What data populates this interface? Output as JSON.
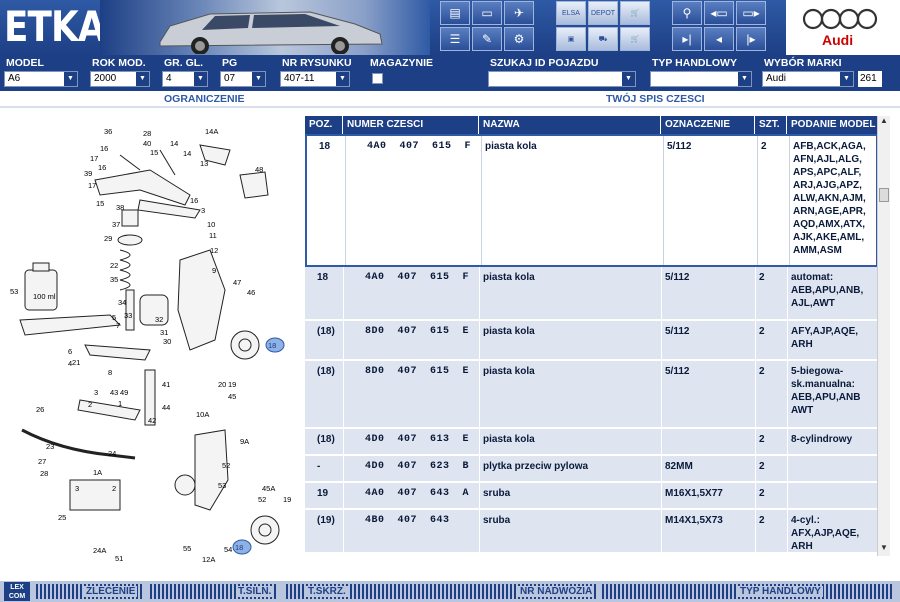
{
  "header": {
    "logo": "ETKA",
    "brand": "Audi"
  },
  "toolbar": {
    "icons": [
      "printer-icon",
      "monitor-icon",
      "fax-icon",
      "list-icon",
      "edit-icon",
      "parts-icon",
      "elsa-icon",
      "depot-icon",
      "cart-icon",
      "pin-icon",
      "prev-page-icon",
      "page-icon",
      "next-page-icon",
      "first-icon",
      "back-icon",
      "forward-icon",
      "last-icon"
    ],
    "elsa_label": "ELSA",
    "depot_label": "DEPOT"
  },
  "filters": {
    "model_label": "MODEL",
    "model_value": "A6",
    "year_label": "ROK MOD.",
    "year_value": "2000",
    "group_label": "GR. GL.",
    "group_value": "4",
    "pg_label": "PG",
    "pg_value": "07",
    "drawing_label": "NR RYSUNKU",
    "drawing_value": "407-11",
    "warehouse_label": "MAGAZYNIE",
    "search_label": "SZUKAJ ID POJAZDU",
    "search_value": "",
    "trade_label": "TYP HANDLOWY",
    "trade_value": "",
    "brand_label": "WYBÓR MARKI",
    "brand_value": "Audi",
    "count": "261"
  },
  "sections": {
    "left": "OGRANICZENIE",
    "right": "TWÓJ SPIS CZESCI"
  },
  "table": {
    "headers": [
      "POZ.",
      "NUMER CZESCI",
      "NAZWA",
      "OZNACZENIE",
      "SZT.",
      "PODANIE MODEL"
    ],
    "rows": [
      {
        "poz": "18",
        "num": "4A0  407  615  F",
        "name": "piasta kola",
        "ozn": "5/112",
        "szt": "2",
        "model": "AFB,ACK,AGA,\nAFN,AJL,ALG,\nAPS,APC,ALF,\nARJ,AJG,APZ,\nALW,AKN,AJM,\nARN,AGE,APR,\nAQD,AMX,ATX,\nAJK,AKE,AML,\nAMM,ASM"
      },
      {
        "poz": "18",
        "num": "4A0  407  615  F",
        "name": "piasta kola",
        "ozn": "5/112",
        "szt": "2",
        "model": "automat:\nAEB,APU,ANB,\nAJL,AWT"
      },
      {
        "poz": "(18)",
        "num": "8D0  407  615  E",
        "name": "piasta kola",
        "ozn": "5/112",
        "szt": "2",
        "model": "AFY,AJP,AQE,\nARH"
      },
      {
        "poz": "(18)",
        "num": "8D0  407  615  E",
        "name": "piasta kola",
        "ozn": "5/112",
        "szt": "2",
        "model": "5-biegowa-\nsk.manualna:\nAEB,APU,ANB\nAWT"
      },
      {
        "poz": "(18)",
        "num": "4D0  407  613  E",
        "name": "piasta kola",
        "ozn": "",
        "szt": "2",
        "model": "8-cylindrowy"
      },
      {
        "poz": "-",
        "num": "4D0  407  623  B",
        "name": "plytka przeciw pylowa",
        "ozn": "82MM",
        "szt": "2",
        "model": ""
      },
      {
        "poz": "19",
        "num": "4A0  407  643  A",
        "name": "sruba",
        "ozn": "M16X1,5X77",
        "szt": "2",
        "model": ""
      },
      {
        "poz": "(19)",
        "num": "4B0  407  643",
        "name": "sruba",
        "ozn": "M14X1,5X73",
        "szt": "2",
        "model": "4-cyl.:\nAFX,AJP,AQE,\nARH"
      }
    ]
  },
  "diagram": {
    "labels": [
      "36",
      "28",
      "40",
      "14A",
      "14",
      "16",
      "17",
      "15",
      "14",
      "13",
      "16",
      "39",
      "48",
      "17",
      "15",
      "16",
      "38",
      "3",
      "10",
      "37",
      "11",
      "29",
      "12",
      "22",
      "9",
      "53",
      "100 ml",
      "35",
      "47",
      "46",
      "34",
      "5",
      "33",
      "7",
      "32",
      "31",
      "18",
      "6",
      "30",
      "4",
      "45",
      "21",
      "8",
      "20",
      "19",
      "43",
      "41",
      "49",
      "3",
      "1",
      "44",
      "2",
      "10A",
      "26",
      "42",
      "9A",
      "52",
      "23",
      "24",
      "1A",
      "27",
      "28",
      "25",
      "3",
      "2",
      "24A",
      "51",
      "53",
      "45A",
      "55",
      "54",
      "12A",
      "19",
      "52"
    ]
  },
  "bottom": {
    "lexcom": "LEX COM",
    "order": "ZLECENIE",
    "engine": "T.SILN.",
    "gearbox": "T.SKRZ.",
    "body_no": "NR NADWOZIA",
    "trade_type": "TYP HANDLOWY"
  }
}
